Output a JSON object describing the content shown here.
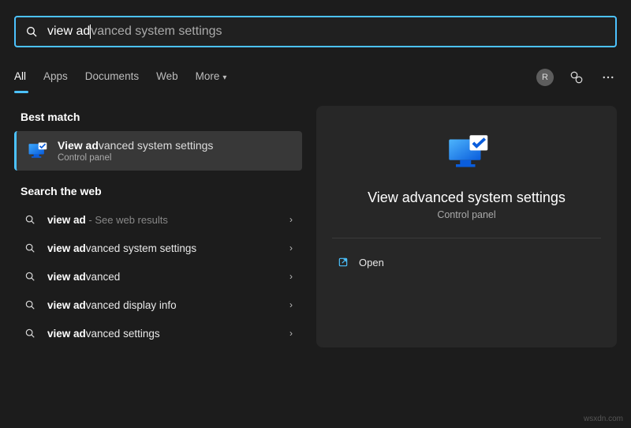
{
  "search": {
    "typed": "view ad",
    "completion": "vanced system settings"
  },
  "tabs": {
    "items": [
      "All",
      "Apps",
      "Documents",
      "Web",
      "More"
    ],
    "active_index": 0
  },
  "header_icons": {
    "avatar_initial": "R"
  },
  "best_match": {
    "section_label": "Best match",
    "title_bold": "View ad",
    "title_rest": "vanced system settings",
    "subtitle": "Control panel"
  },
  "web": {
    "section_label": "Search the web",
    "items": [
      {
        "bold": "view ad",
        "rest": "",
        "hint": " - See web results"
      },
      {
        "bold": "view ad",
        "rest": "vanced system settings",
        "hint": ""
      },
      {
        "bold": "view ad",
        "rest": "vanced",
        "hint": ""
      },
      {
        "bold": "view ad",
        "rest": "vanced display info",
        "hint": ""
      },
      {
        "bold": "view ad",
        "rest": "vanced settings",
        "hint": ""
      }
    ]
  },
  "detail": {
    "title": "View advanced system settings",
    "subtitle": "Control panel",
    "actions": [
      {
        "label": "Open"
      }
    ]
  },
  "watermark": "wsxdn.com"
}
